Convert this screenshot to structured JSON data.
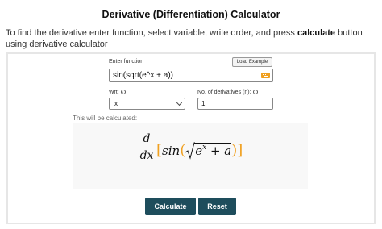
{
  "page": {
    "title": "Derivative (Differentiation) Calculator",
    "intro_part1": "To find the derivative enter function, select variable, write order, and press ",
    "intro_bold": "calculate",
    "intro_part2": " button using derivative calculator"
  },
  "form": {
    "function_label": "Enter function",
    "load_example_label": "Load Example",
    "function_value": "sin(sqrt(e^x + a))",
    "wrt_label": "Wrt:",
    "wrt_value": "x",
    "num_derivatives_label": "No. of derivatives (n):",
    "num_derivatives_value": "1",
    "info_glyph": "i"
  },
  "preview": {
    "note": "This will be calculated:",
    "d_numerator": "d",
    "d_denominator": "dx",
    "open_bracket": "[",
    "sin_text": "sin",
    "open_paren": "(",
    "base_e": "e",
    "exponent": "x",
    "plus_a": " + a",
    "close_paren": ")",
    "close_bracket": "]"
  },
  "buttons": {
    "calculate_label": "Calculate",
    "reset_label": "Reset"
  },
  "colors": {
    "button_bg": "#1e4d5c",
    "accent_orange": "#f0a020"
  },
  "icons": {
    "keyboard": "keyboard-icon",
    "info": "info-icon",
    "chevron": "chevron-down-icon"
  }
}
